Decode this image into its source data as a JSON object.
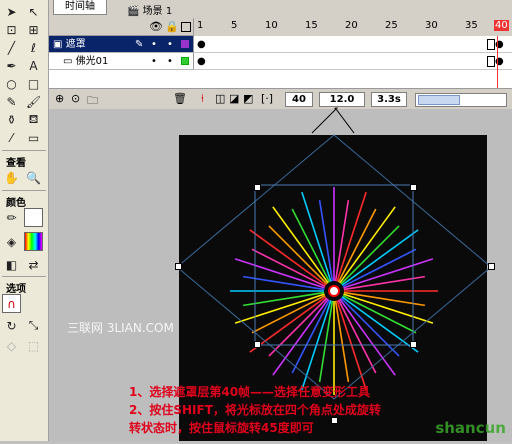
{
  "timeline": {
    "tab": "时间轴",
    "scene": "场景 1",
    "layers": [
      {
        "name": "遮罩",
        "color": "#9933cc",
        "active": true
      },
      {
        "name": "佛光01",
        "color": "#33cc33",
        "active": false
      }
    ],
    "ruler_labels": [
      "1",
      "5",
      "10",
      "15",
      "20",
      "25",
      "30",
      "35",
      "40"
    ],
    "current_frame": "40",
    "fps": "12.0 fps",
    "time": "3.3s"
  },
  "tools": {
    "section_view": "查看",
    "section_colors": "颜色",
    "section_options": "选项"
  },
  "watermark": "三联网 3LIAN.COM",
  "instructions": [
    "1、选择遮罩层第40帧——选择任意变形工具",
    "2、按住SHIFT，将光标放在四个角点处成旋转",
    "转状态时，按住鼠标旋转45度即可"
  ],
  "logo": "shancun"
}
